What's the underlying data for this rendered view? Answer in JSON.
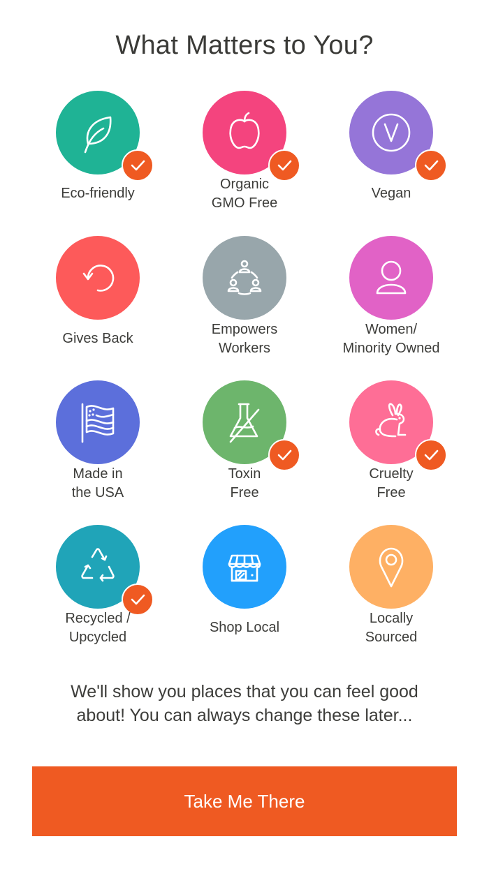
{
  "header": {
    "title": "What Matters to You?"
  },
  "colors": {
    "accent": "#ef5a22",
    "text": "#3d3d3a"
  },
  "options": [
    {
      "id": "eco-friendly",
      "label_lines": [
        "Eco-friendly"
      ],
      "icon": "leaf-icon",
      "color": "#1fb395",
      "selected": true
    },
    {
      "id": "organic-gmo-free",
      "label_lines": [
        "Organic",
        "GMO Free"
      ],
      "icon": "apple-icon",
      "color": "#f4447e",
      "selected": true
    },
    {
      "id": "vegan",
      "label_lines": [
        "Vegan"
      ],
      "icon": "vegan-v-icon",
      "color": "#9575d8",
      "selected": true
    },
    {
      "id": "gives-back",
      "label_lines": [
        "Gives Back"
      ],
      "icon": "circular-arrow-icon",
      "color": "#fd5a5a",
      "selected": false
    },
    {
      "id": "empowers-workers",
      "label_lines": [
        "Empowers",
        "Workers"
      ],
      "icon": "people-network-icon",
      "color": "#98a6ab",
      "selected": false
    },
    {
      "id": "women-minority-owned",
      "label_lines": [
        "Women/",
        "Minority Owned"
      ],
      "icon": "person-icon",
      "color": "#e162c6",
      "selected": false
    },
    {
      "id": "made-in-usa",
      "label_lines": [
        "Made in",
        "the USA"
      ],
      "icon": "us-flag-icon",
      "color": "#5c6fdb",
      "selected": false
    },
    {
      "id": "toxin-free",
      "label_lines": [
        "Toxin",
        "Free"
      ],
      "icon": "flask-crossed-icon",
      "color": "#6db56c",
      "selected": true
    },
    {
      "id": "cruelty-free",
      "label_lines": [
        "Cruelty",
        "Free"
      ],
      "icon": "rabbit-icon",
      "color": "#fe6e96",
      "selected": true
    },
    {
      "id": "recycled-upcycled",
      "label_lines": [
        "Recycled /",
        "Upcycled"
      ],
      "icon": "recycle-icon",
      "color": "#20a4b8",
      "selected": true
    },
    {
      "id": "shop-local",
      "label_lines": [
        "Shop Local"
      ],
      "icon": "storefront-icon",
      "color": "#22a0fc",
      "selected": false
    },
    {
      "id": "locally-sourced",
      "label_lines": [
        "Locally",
        "Sourced"
      ],
      "icon": "map-pin-icon",
      "color": "#feb064",
      "selected": false
    }
  ],
  "footer": {
    "message_line1": "We'll show you places that you can feel good",
    "message_line2": "about! You can always change these later...",
    "cta_label": "Take Me There"
  }
}
